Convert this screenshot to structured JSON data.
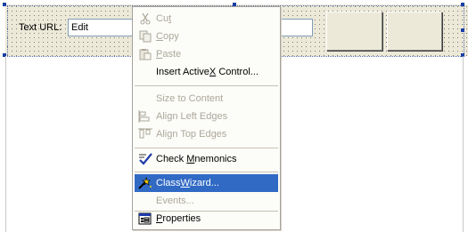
{
  "dialog": {
    "label": "Text URL:",
    "edit_value": "Edit"
  },
  "menu": {
    "items": [
      {
        "pre": "Cu",
        "mn": "t",
        "post": "",
        "icon": "scissors-icon",
        "enabled": false
      },
      {
        "pre": "",
        "mn": "C",
        "post": "opy",
        "icon": "copy-icon",
        "enabled": false
      },
      {
        "pre": "",
        "mn": "P",
        "post": "aste",
        "icon": "paste-icon",
        "enabled": false
      },
      {
        "pre": "Insert Active",
        "mn": "X",
        "post": " Control...",
        "icon": "",
        "enabled": true
      },
      {
        "pre": "Size to Content",
        "mn": "",
        "post": "",
        "icon": "",
        "enabled": false
      },
      {
        "pre": "Align Left Edges",
        "mn": "",
        "post": "",
        "icon": "align-left-icon",
        "enabled": false
      },
      {
        "pre": "Align Top Edges",
        "mn": "",
        "post": "",
        "icon": "align-top-icon",
        "enabled": false
      },
      {
        "pre": "Check ",
        "mn": "M",
        "post": "nemonics",
        "icon": "check-mnemonics-icon",
        "enabled": true
      },
      {
        "pre": "Class",
        "mn": "W",
        "post": "izard...",
        "icon": "wizard-icon",
        "enabled": true,
        "highlighted": true
      },
      {
        "pre": "Events...",
        "mn": "",
        "post": "",
        "icon": "",
        "enabled": false
      },
      {
        "pre": "",
        "mn": "P",
        "post": "roperties",
        "icon": "properties-icon",
        "enabled": true
      }
    ]
  },
  "colors": {
    "highlight": "#316ac5",
    "disabled_text": "#aca899",
    "dialog_bg": "#ece9d8"
  }
}
